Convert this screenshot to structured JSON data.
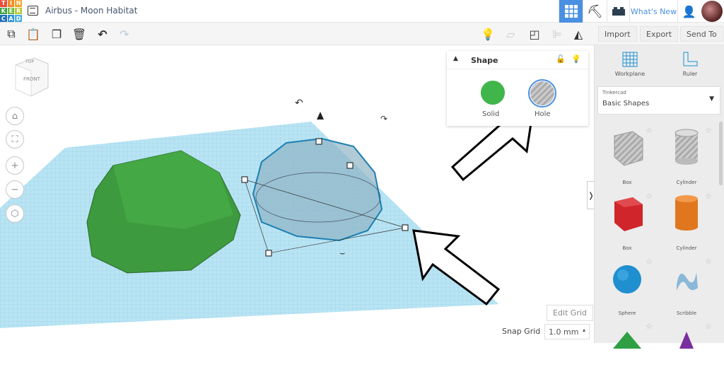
{
  "header": {
    "logo_letters": [
      "T",
      "I",
      "N",
      "K",
      "E",
      "R",
      "C",
      "A",
      "D"
    ],
    "title": "Airbus - Moon Habitat",
    "whats_new": "What's New"
  },
  "toolbar": {
    "import": "Import",
    "export": "Export",
    "send_to": "Send To"
  },
  "view_cube": {
    "top": "TOP",
    "front": "FRONT"
  },
  "shape_panel": {
    "title": "Shape",
    "solid": "Solid",
    "hole": "Hole"
  },
  "right_panel": {
    "workplane": "Workplane",
    "ruler": "Ruler",
    "library_source": "Tinkercad",
    "library_name": "Basic Shapes",
    "shapes": [
      {
        "label": "Box"
      },
      {
        "label": "Cylinder"
      },
      {
        "label": "Box"
      },
      {
        "label": "Cylinder"
      },
      {
        "label": "Sphere"
      },
      {
        "label": "Scribble"
      }
    ]
  },
  "grid": {
    "edit_grid": "Edit Grid",
    "snap_grid_label": "Snap Grid",
    "snap_grid_value": "1.0 mm"
  },
  "colors": {
    "accent": "#4a90e2",
    "solid": "#3fb54a",
    "workplane": "#a8dcef"
  }
}
